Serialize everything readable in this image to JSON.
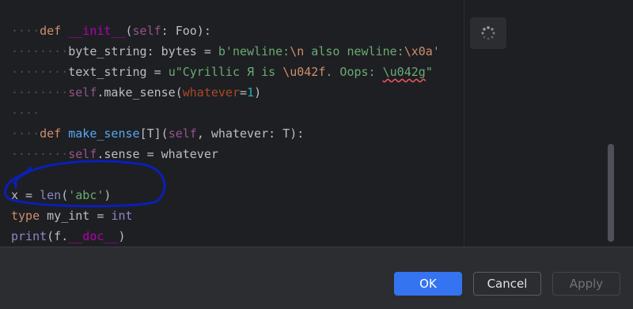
{
  "editor": {
    "lines": [
      [
        {
          "t": "····",
          "c": "ws"
        },
        {
          "t": "def ",
          "c": "kw"
        },
        {
          "t": "__init__",
          "c": "dunder"
        },
        {
          "t": "(",
          "c": ""
        },
        {
          "t": "self",
          "c": "self"
        },
        {
          "t": ": Foo):",
          "c": ""
        }
      ],
      [
        {
          "t": "········",
          "c": "ws"
        },
        {
          "t": "byte_string",
          "c": ""
        },
        {
          "t": ": bytes = ",
          "c": ""
        },
        {
          "t": "b'newline:",
          "c": "str"
        },
        {
          "t": "\\n",
          "c": "esc"
        },
        {
          "t": " also newline:",
          "c": "str"
        },
        {
          "t": "\\x0a",
          "c": "esc"
        },
        {
          "t": "'",
          "c": "str"
        }
      ],
      [
        {
          "t": "········",
          "c": "ws"
        },
        {
          "t": "text_string",
          "c": ""
        },
        {
          "t": " = ",
          "c": ""
        },
        {
          "t": "u\"Cyrillic Я is ",
          "c": "str"
        },
        {
          "t": "\\u042f",
          "c": "esc"
        },
        {
          "t": ". Oops: ",
          "c": "str"
        },
        {
          "t": "\\u042g",
          "c": "str err"
        },
        {
          "t": "\"",
          "c": "str"
        }
      ],
      [
        {
          "t": "········",
          "c": "ws"
        },
        {
          "t": "self",
          "c": "self"
        },
        {
          "t": ".make_sense(",
          "c": ""
        },
        {
          "t": "whatever",
          "c": "param"
        },
        {
          "t": "=",
          "c": ""
        },
        {
          "t": "1",
          "c": "num"
        },
        {
          "t": ")",
          "c": ""
        }
      ],
      [
        {
          "t": "····",
          "c": "ws"
        }
      ],
      [
        {
          "t": "····",
          "c": "ws"
        },
        {
          "t": "def ",
          "c": "kw"
        },
        {
          "t": "make_sense",
          "c": "fn"
        },
        {
          "t": "[T](",
          "c": ""
        },
        {
          "t": "self",
          "c": "self"
        },
        {
          "t": ", whatever: T):",
          "c": ""
        }
      ],
      [
        {
          "t": "········",
          "c": "ws"
        },
        {
          "t": "self",
          "c": "self"
        },
        {
          "t": ".sense = whatever",
          "c": ""
        }
      ],
      [],
      [
        {
          "t": "x = ",
          "c": ""
        },
        {
          "t": "len",
          "c": "builtin"
        },
        {
          "t": "(",
          "c": ""
        },
        {
          "t": "'abc'",
          "c": "str"
        },
        {
          "t": ")",
          "c": ""
        }
      ],
      [
        {
          "t": "type ",
          "c": "kw"
        },
        {
          "t": "my_int = ",
          "c": ""
        },
        {
          "t": "int",
          "c": "builtin"
        }
      ],
      [
        {
          "t": "print",
          "c": "builtin"
        },
        {
          "t": "(f.",
          "c": ""
        },
        {
          "t": "__doc__",
          "c": "dunder"
        },
        {
          "t": ")",
          "c": ""
        }
      ]
    ]
  },
  "colors": {
    "accent": "#3574f0",
    "annotation": "#0b1fb8"
  },
  "icons": {
    "spinner": "loading-spinner-icon"
  },
  "buttons": {
    "ok": "OK",
    "cancel": "Cancel",
    "apply": "Apply"
  }
}
